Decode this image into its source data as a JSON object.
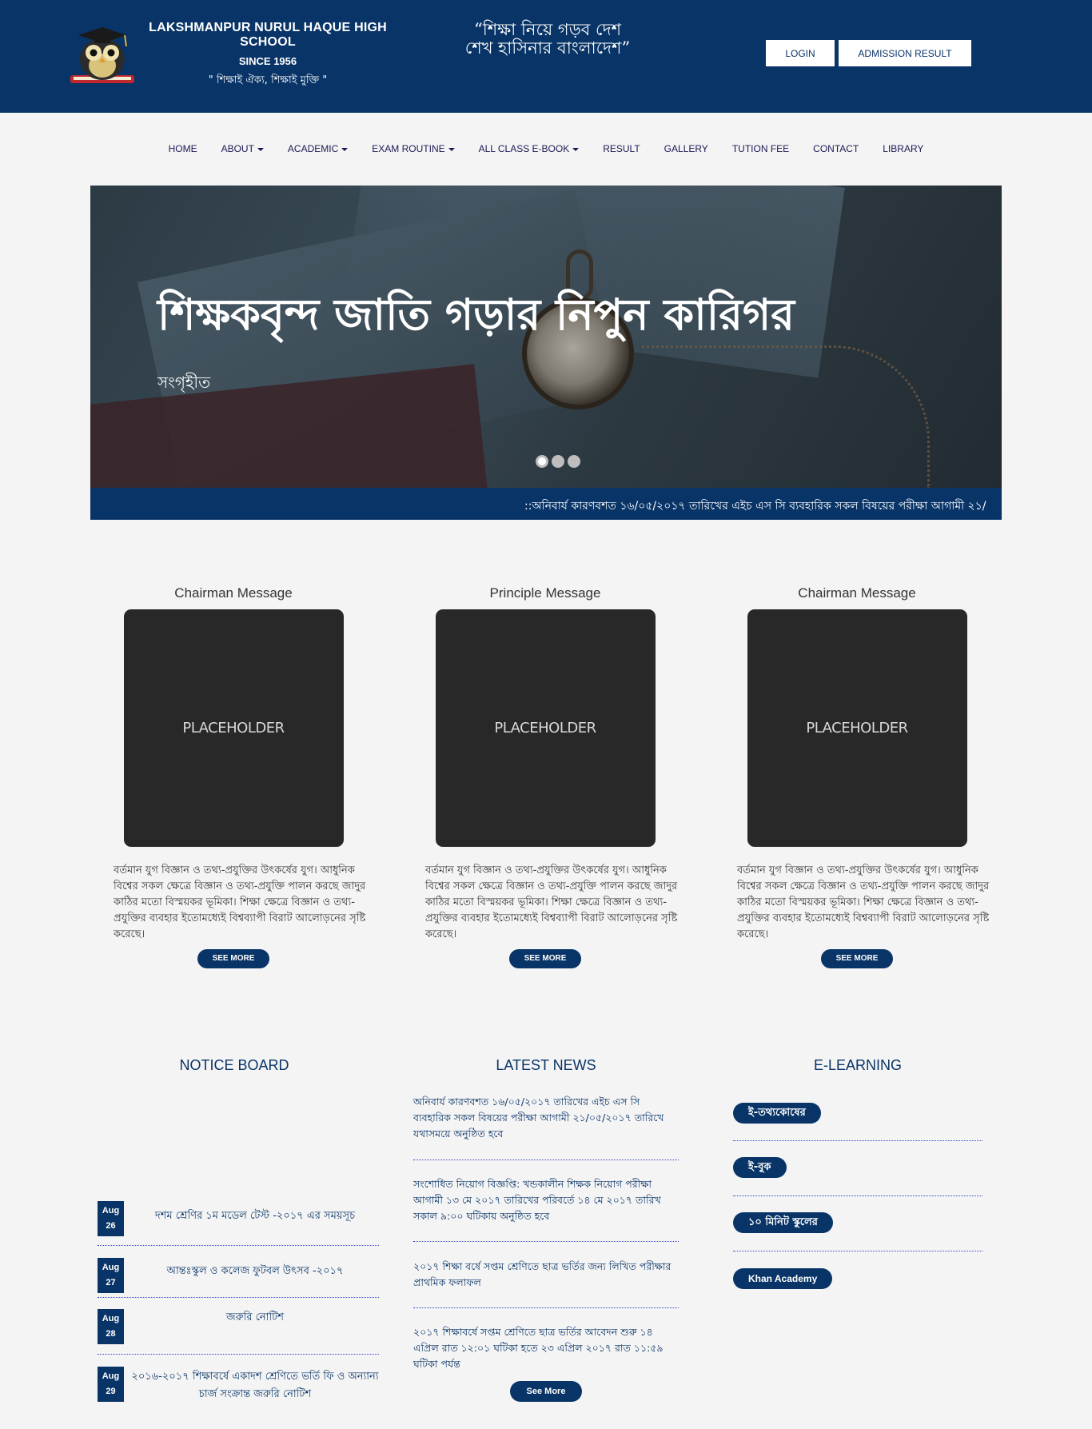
{
  "header": {
    "school_name": "LAKSHMANPUR NURUL HAQUE HIGH SCHOOL",
    "since": "SINCE 1956",
    "motto": "\" শিক্ষাই ঐক্য, শিক্ষাই মুক্তি \"",
    "slogan": "“শিক্ষা নিয়ে গড়ব দেশ শেখ হাসিনার বাংলাদেশ”",
    "login_label": "LOGIN",
    "admission_label": "ADMISSION RESULT"
  },
  "nav": {
    "items": [
      {
        "label": "HOME",
        "dropdown": false
      },
      {
        "label": "ABOUT",
        "dropdown": true
      },
      {
        "label": "ACADEMIC",
        "dropdown": true
      },
      {
        "label": "EXAM ROUTINE",
        "dropdown": true
      },
      {
        "label": "ALL CLASS E-BOOK",
        "dropdown": true
      },
      {
        "label": "RESULT",
        "dropdown": false
      },
      {
        "label": "GALLERY",
        "dropdown": false
      },
      {
        "label": "TUTION FEE",
        "dropdown": false
      },
      {
        "label": "CONTACT",
        "dropdown": false
      },
      {
        "label": "LIBRARY",
        "dropdown": false
      }
    ]
  },
  "hero": {
    "title": "শিক্ষকবৃন্দ জাতি গড়ার নিপুন কারিগর",
    "subtitle": "সংগৃহীত",
    "slides": 3,
    "active_slide": 1
  },
  "ticker": {
    "text": "::অনিবার্য কারণবশত ১৬/০৫/২০১৭ তারিখের এইচ এস সি ব্যবহারিক সকল বিষয়ের পরীক্ষা আগামী ২১/"
  },
  "messages": [
    {
      "title": "Chairman Message",
      "image_label": "PLACEHOLDER",
      "text": "বর্তমান যুগ বিজ্ঞান ও তথ্য-প্রযুক্তির উৎকর্ষের যুগ। আধুনিক বিশ্বের সকল ক্ষেত্রে বিজ্ঞান ও তথ্য-প্রযুক্তি পালন করছে জাদুর কাঠির মতো বিস্ময়কর ভূমিকা। শিক্ষা ক্ষেত্রে বিজ্ঞান ও তথ্য-প্রযুক্তির ব্যবহার ইতোমধ্যেই বিশ্বব্যাপী বিরাট আলোড়নের সৃষ্টি করেছে।",
      "button": "SEE MORE"
    },
    {
      "title": "Principle Message",
      "image_label": "PLACEHOLDER",
      "text": "বর্তমান যুগ বিজ্ঞান ও তথ্য-প্রযুক্তির উৎকর্ষের যুগ। আধুনিক বিশ্বের সকল ক্ষেত্রে বিজ্ঞান ও তথ্য-প্রযুক্তি পালন করছে জাদুর কাঠির মতো বিস্ময়কর ভূমিকা। শিক্ষা ক্ষেত্রে বিজ্ঞান ও তথ্য-প্রযুক্তির ব্যবহার ইতোমধ্যেই বিশ্বব্যাপী বিরাট আলোড়নের সৃষ্টি করেছে।",
      "button": "SEE MORE"
    },
    {
      "title": "Chairman Message",
      "image_label": "PLACEHOLDER",
      "text": "বর্তমান যুগ বিজ্ঞান ও তথ্য-প্রযুক্তির উৎকর্ষের যুগ। আধুনিক বিশ্বের সকল ক্ষেত্রে বিজ্ঞান ও তথ্য-প্রযুক্তি পালন করছে জাদুর কাঠির মতো বিস্ময়কর ভূমিকা। শিক্ষা ক্ষেত্রে বিজ্ঞান ও তথ্য-প্রযুক্তির ব্যবহার ইতোমধ্যেই বিশ্বব্যাপী বিরাট আলোড়নের সৃষ্টি করেছে।",
      "button": "SEE MORE"
    }
  ],
  "notice_board": {
    "title": "NOTICE BOARD",
    "items": [
      {
        "month": "Aug",
        "day": "26",
        "text": "দশম শ্রেণির ১ম মডেল টেস্ট -২০১৭ এর সময়সূচ"
      },
      {
        "month": "Aug",
        "day": "27",
        "text": "আন্তঃস্কুল ও কলেজ ফুটবল উৎসব -২০১৭"
      },
      {
        "month": "Aug",
        "day": "28",
        "text": "জরুরি নোটিশ"
      },
      {
        "month": "Aug",
        "day": "29",
        "text": "২০১৬-২০১৭ শিক্ষাবর্ষে একাদশ শ্রেণিতে ভর্তি ফি ও অন্যান্য চার্জ সংক্রান্ত জরুরি নোটিশ"
      }
    ]
  },
  "latest_news": {
    "title": "LATEST NEWS",
    "items": [
      "অনিবার্য কারণবশত ১৬/০৫/২০১৭ তারিখের এইচ এস সি ব্যবহারিক সকল বিষয়ের পরীক্ষা আগামী ২১/০৫/২০১৭ তারিখে যথাসময়ে অনুষ্ঠিত হবে",
      "সংশোধিত নিয়োগ বিজ্ঞপ্তি: খন্ডকালীন শিক্ষক নিয়োগ পরীক্ষা আগামী ১৩ মে ২০১৭ তারিখের পরিবর্তে ১৪ মে ২০১৭ তারিখ সকাল ৯:০০ ঘটিকায় অনুষ্ঠিত হবে",
      "২০১৭ শিক্ষা বর্ষে সপ্তম শ্রেণিতে ছাত্র ভর্তির জন্য লিখিত পরীক্ষার প্রাথমিক ফলাফল",
      "২০১৭ শিক্ষাবর্ষে সপ্তম শ্রেণিতে ছাত্র ভর্তির আবেদন শুরু ১৪ এপ্রিল রাত ১২:০১ ঘটিকা হতে ২৩ এপ্রিল ২০১৭ রাত ১১:৫৯ ঘটিকা পর্যন্ত"
    ],
    "button": "See More"
  },
  "elearning": {
    "title": "E-LEARNING",
    "items": [
      "ই-তথ্যকোষের",
      "ই-বুক",
      "১০ মিনিট স্কুলের",
      "Khan Academy"
    ]
  },
  "colors": {
    "primary": "#083467",
    "background": "#f4f4f4",
    "placeholder": "#282828"
  }
}
